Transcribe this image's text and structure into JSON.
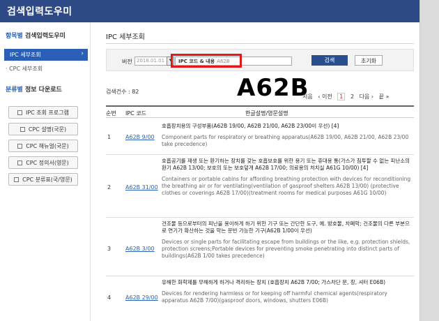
{
  "header": {
    "title": "검색입력도우미"
  },
  "sidebar": {
    "section1_title_hl": "항목별",
    "section1_title": " 검색입력도우미",
    "active_item": "IPC 세부조회",
    "sub_item": "· CPC 세부조회",
    "section2_title_hl": "분류별",
    "section2_title": " 정보 다운로드",
    "buttons": [
      "IPC 조회 프로그램",
      "CPC 설명(국문)",
      "CPC 해뉴얼(국문)",
      "CPC 정의서(영문)",
      "CPC 분류표(국/영문)"
    ]
  },
  "main": {
    "page_title": "IPC 세부조회",
    "search": {
      "version_label": "버전",
      "version_value": "2018.01.01",
      "query_label": "IPC 코드 & 내용",
      "query_value": "A62B",
      "search_button": "검색",
      "reset_button": "초기화"
    },
    "overlay_text": "A62B",
    "count_label": "검색건수 : 82",
    "pager": {
      "first": "처음",
      "prev": "‹ 이전",
      "page1": "1",
      "page2": "2",
      "next": "다음 ›",
      "last": "끝 »"
    },
    "table": {
      "headers": {
        "no": "순번",
        "code": "IPC 코드",
        "desc": "한글설명/영문설명"
      },
      "rows": [
        {
          "no": "1",
          "code": "A62B 9/00",
          "kr": "호흡장치용의 구성부품(A62B 19/00, A62B 21/00, A62B 23/00이 우선) [4]",
          "en": "Component parts for respiratory or breathing apparatus(A62B 19/00, A62B 21/00, A62B 23/00 take precedence)"
        },
        {
          "no": "2",
          "code": "A62B 31/00",
          "kr": "호흡공기를 재생 또는 환기하는 장치를 갖는 호흡보호를 위한 용기 또는 휴대용 통(가스가 침투할 수 없는 피난소의 환기 A62B 13/00; 보호의 또는 보호덮개 A62B 17/00; 의료용의 처치실 A61G 10/00) [4]",
          "en": "Containers or portable cabins for affording breathing protection with devices for reconditioning the breathing air or for ventilating(ventilation of gasproof shelters A62B 13/00) (protective clothes or coverings A62B 17/00)(treatment rooms for medical purposes A61G 10/00)"
        },
        {
          "no": "3",
          "code": "A62B 3/00",
          "kr": "건조물 등으로부터의 피난을 용이하게 하기 위한 기구 또는 간단한 도구, 예. 방호물, 차폐막; 건조물의 다른 부분으로 연기가 확산하는 것을 막는 문빈 가능한 기구(A62B 1/00이 우선)",
          "en": "Devices or single parts for facilitating escape from buildings or the like, e.g. protection shields, protection screens;Portable devices for preventing smoke penetrating into distinct parts of buildings(A62B 1/00 takes precedence)"
        },
        {
          "no": "4",
          "code": "A62B 29/00",
          "kr": "유해한 화학제를 무해하게 하거나 격리하는 장치 (호흡장치 A62B 7/00; 가스차단 문, 창, 셔터 E06B)",
          "en": "Devices for rendering harmless or for keeping off harmful chemical agents(respiratory apparatus A62B 7/00)(gasproof doors, windows, shutters E06B)"
        }
      ]
    }
  }
}
